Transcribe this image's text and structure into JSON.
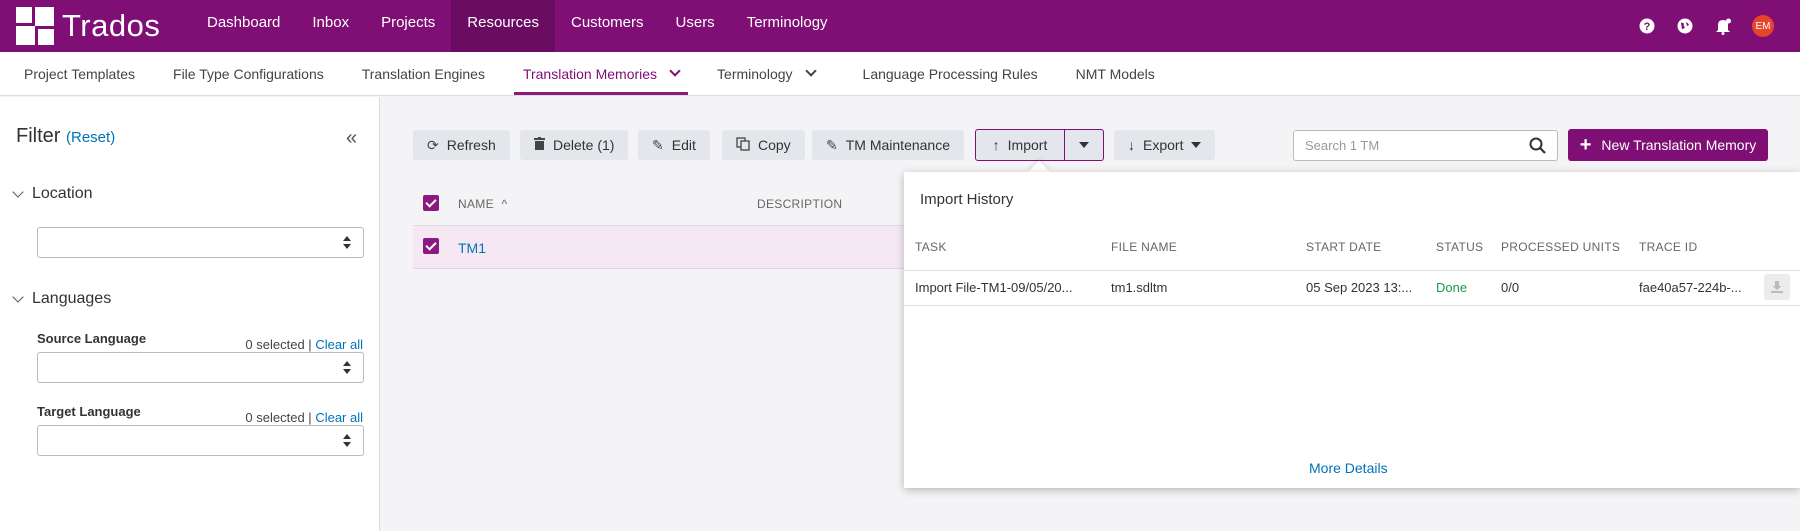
{
  "app": {
    "name": "Trados"
  },
  "nav": [
    "Dashboard",
    "Inbox",
    "Projects",
    "Resources",
    "Customers",
    "Users",
    "Terminology"
  ],
  "top_icons": {
    "help": "question-icon",
    "language": "globe-icon",
    "notifications": "bell-icon",
    "avatar_initials": "EM"
  },
  "subnav": [
    "Project Templates",
    "File Type Configurations",
    "Translation Engines",
    "Translation Memories",
    "Terminology",
    "Language Processing Rules",
    "NMT Models"
  ],
  "filter": {
    "title": "Filter",
    "reset": "(Reset)",
    "location_label": "Location",
    "languages_label": "Languages",
    "source_label": "Source Language",
    "target_label": "Target Language",
    "selected_text": "0 selected",
    "separator": "|",
    "clear_all": "Clear all"
  },
  "toolbar": {
    "refresh": "Refresh",
    "delete": "Delete (1)",
    "edit": "Edit",
    "copy": "Copy",
    "tm_maintenance": "TM Maintenance",
    "import": "Import",
    "export": "Export",
    "search_placeholder": "Search 1 TM",
    "new_tm": "New Translation Memory"
  },
  "grid": {
    "columns": [
      "NAME",
      "DESCRIPTION"
    ],
    "rows": [
      {
        "name": "TM1"
      }
    ]
  },
  "import_history": {
    "title": "Import History",
    "columns": [
      "TASK",
      "FILE NAME",
      "START DATE",
      "STATUS",
      "PROCESSED UNITS",
      "TRACE ID"
    ],
    "rows": [
      {
        "task": "Import File-TM1-09/05/20...",
        "file": "tm1.sdltm",
        "start": "05 Sep 2023 13:...",
        "status": "Done",
        "units": "0/0",
        "trace": "fae40a57-224b-..."
      }
    ],
    "more": "More Details"
  },
  "colors": {
    "brand": "#7f0e75",
    "link": "#0073b7",
    "done": "#1a9a4a"
  }
}
